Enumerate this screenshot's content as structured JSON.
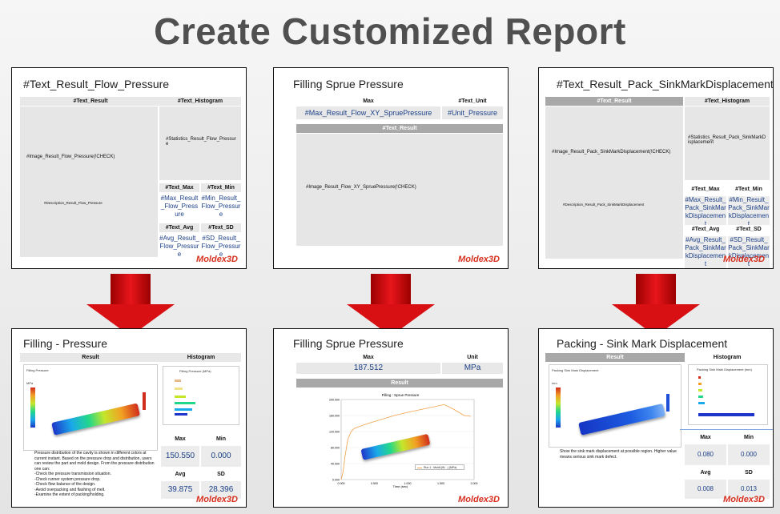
{
  "page": {
    "title": "Create Customized Report"
  },
  "top_slides": [
    {
      "title": "#Text_Result_Flow_Pressure",
      "result_header": "#Text_Result",
      "histogram_header": "#Text_Histogram",
      "image_text": "#Image_Result_Flow_Pressure(!CHECK)",
      "statistics_text": "#Statistics_Result_Flow_Pressure",
      "description_text": "#Description_Result_Flow_Pressure",
      "max_header": "#Text_Max",
      "min_header": "#Text_Min",
      "avg_header": "#Text_Avg",
      "sd_header": "#Text_SD",
      "max_value": "#Max_Result_Flow_Pressure",
      "min_value": "#Min_Result_Flow_Pressure",
      "avg_value": "#Avg_Result_Flow_Pressure",
      "sd_value": "#SD_Result_Flow_Pressure",
      "logo": "Moldex3D"
    },
    {
      "title": "Filling Sprue Pressure",
      "max_header": "Max",
      "unit_header": "#Text_Unit",
      "max_value": "#Max_Result_Flow_XY_SpruePressure",
      "unit_value": "#Unit_Pressure",
      "result_header": "#Text_Result",
      "image_text": "#Image_Result_Flow_XY_SpruePressure(!CHECK)",
      "logo": "Moldex3D"
    },
    {
      "title": "#Text_Result_Pack_SinkMarkDisplacement",
      "result_header": "#Text_Result",
      "histogram_header": "#Text_Histogram",
      "image_text": "#Image_Result_Pack_SinkMarkDisplacement(!CHECK)",
      "statistics_text": "#Statistics_Result_Pack_SinkMarkDisplacement",
      "description_text": "#Description_Result_Pack_SinkMarkDisplacement",
      "max_header": "#Text_Max",
      "min_header": "#Text_Min",
      "avg_header": "#Text_Avg",
      "sd_header": "#Text_SD",
      "max_value": "#Max_Result_Pack_SinkMarkDisplacement",
      "min_value": "#Min_Result_Pack_SinkMarkDisplacement",
      "avg_value": "#Avg_Result_Pack_SinkMarkDisplacement",
      "sd_value": "#SD_Result_Pack_SinkMarkDisplacement",
      "logo": "Moldex3D"
    }
  ],
  "bottom_slides": [
    {
      "title": "Filling - Pressure",
      "result_header": "Result",
      "histogram_header": "Histogram",
      "max_header": "Max",
      "min_header": "Min",
      "avg_header": "Avg",
      "sd_header": "SD",
      "max_value": "150.550",
      "min_value": "0.000",
      "avg_value": "39.875",
      "sd_value": "28.396",
      "image_caption": "Filling Pressure",
      "unit": "MPa",
      "histogram_title": "Filling Pressure (MPa)",
      "description": "Pressure distribution of the cavity is shown in different colors at current instant. Based on the pressure drop and distribution, users can review the part and mold design. From the pressure distribution one can:\n-Check the pressure transmission situation.\n-Check runner system pressure drop.\n-Check flow balance of the design.\n-Avoid overpacking and flashing of melt.\n-Examine the extent of packing/holding.",
      "logo": "Moldex3D"
    },
    {
      "title": "Filling Sprue Pressure",
      "max_header": "Max",
      "unit_header": "Unit",
      "max_value": "187.512",
      "unit_value": "MPa",
      "result_header": "Result",
      "chart_title": "Filling : Sprue Pressure",
      "legend": "Run 1 : Mold1(W…) (MPa)",
      "x_label": "Time (sec)",
      "logo": "Moldex3D"
    },
    {
      "title": "Packing - Sink Mark Displacement",
      "result_header": "Result",
      "histogram_header": "Histogram",
      "max_header": "Max",
      "min_header": "Min",
      "avg_header": "Avg",
      "sd_header": "SD",
      "max_value": "0.080",
      "min_value": "0.000",
      "avg_value": "0.008",
      "sd_value": "0.013",
      "image_caption": "Packing Sink Mark Displacement",
      "unit": "mm",
      "histogram_title": "Packing Sink Mark Displacement (mm)",
      "description": "Show the sink mark displacement at possible region. Higher value means serious sink mark defect.",
      "logo": "Moldex3D"
    }
  ],
  "chart_data": {
    "type": "line",
    "title": "Filling : Sprue Pressure",
    "xlabel": "Time (sec)",
    "ylabel": "",
    "x_ticks": [
      "0.000",
      "0.500",
      "1.000",
      "1.500",
      "2.000"
    ],
    "y_ticks": [
      "0.000",
      "40.000",
      "80.000",
      "120.000",
      "160.000",
      "200.000"
    ],
    "xlim": [
      0,
      2.0
    ],
    "ylim": [
      0,
      200
    ],
    "series": [
      {
        "name": "Run 1 : Mold1(W…) (MPa)",
        "color": "#f0a14a",
        "x": [
          0,
          0.03,
          0.06,
          0.1,
          0.15,
          0.2,
          0.4,
          0.6,
          0.8,
          1.0,
          1.2,
          1.4,
          1.55,
          1.7,
          1.85,
          1.95
        ],
        "y": [
          0,
          20,
          60,
          100,
          120,
          128,
          140,
          150,
          160,
          168,
          175,
          182,
          187.5,
          175,
          160,
          158
        ]
      }
    ]
  },
  "colors": {
    "accent": "#d7301f",
    "value_text": "#1b3f86",
    "header_grey": "#e8e8e8",
    "header_dark": "#a8a8a8",
    "arrow": "#d81014"
  }
}
